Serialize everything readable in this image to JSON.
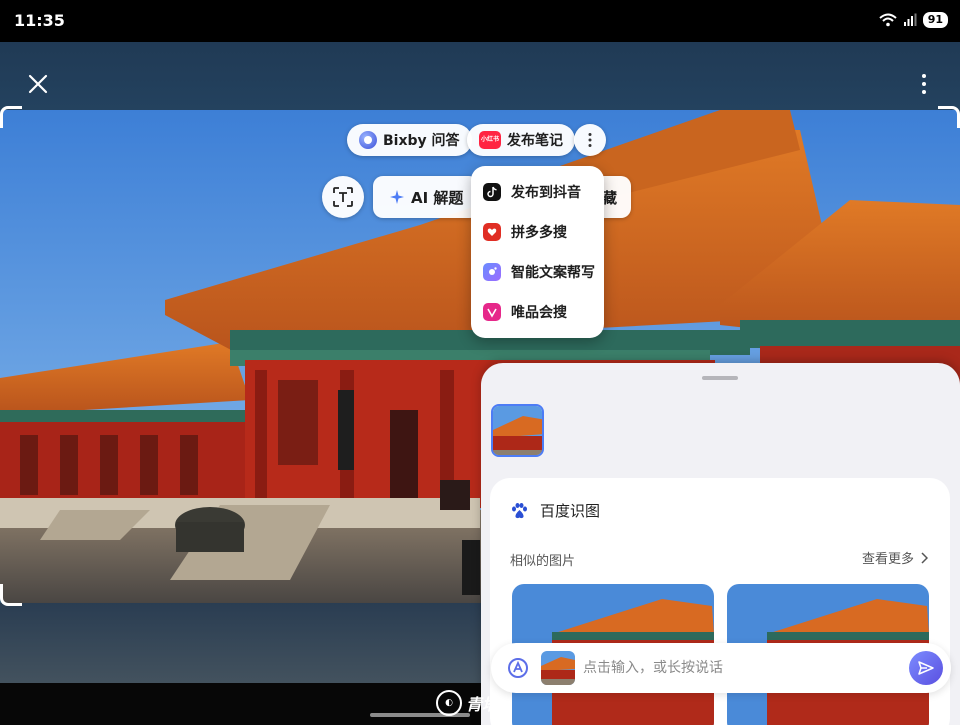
{
  "status_bar": {
    "time": "11:35",
    "battery": "91"
  },
  "toolbar": {
    "close_icon": "close-icon",
    "more_icon": "more-vertical-icon"
  },
  "chips": {
    "bixby": "Bixby 问答",
    "publish_note": "发布笔记",
    "xhs_logo_text": "小红书",
    "ai_solve": "AI 解题",
    "save_partial": "藏"
  },
  "share_menu": {
    "items": [
      {
        "label": "发布到抖音",
        "icon": "tiktok-icon"
      },
      {
        "label": "拼多多搜",
        "icon": "pinduoduo-icon"
      },
      {
        "label": "智能文案帮写",
        "icon": "ai-write-icon"
      },
      {
        "label": "唯品会搜",
        "icon": "vipshop-icon"
      }
    ]
  },
  "sheet": {
    "card_title": "百度识图",
    "similar_label": "相似的图片",
    "see_more": "查看更多",
    "input_placeholder": "点击输入，或长按说话"
  },
  "watermark": {
    "text": "青塔"
  },
  "colors": {
    "accent": "#4d7cf5",
    "xhs_red": "#ff2442",
    "send": "#6b6cf0"
  }
}
